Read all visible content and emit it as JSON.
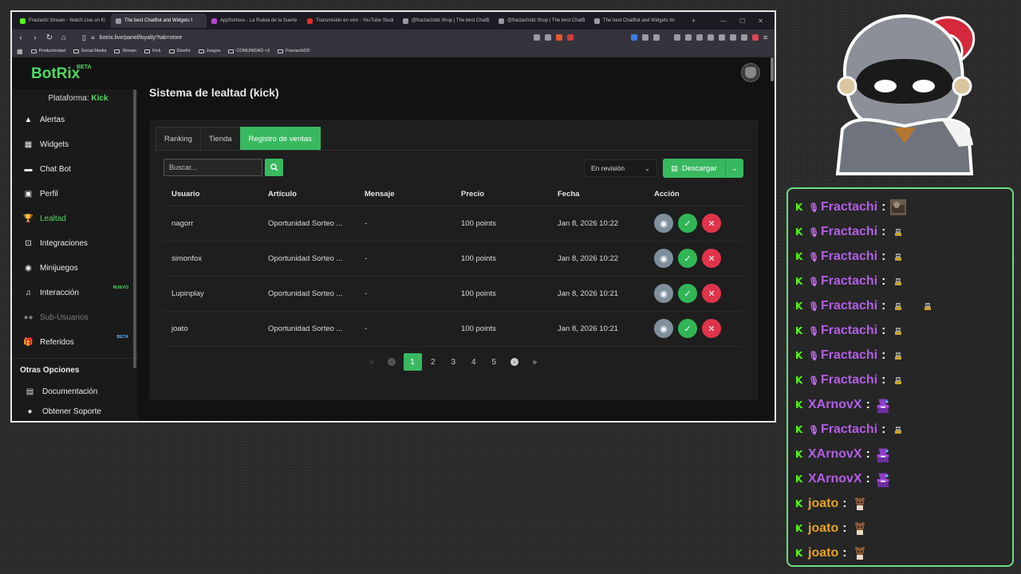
{
  "browser": {
    "tabs": [
      {
        "title": "Fractachi Stream - Watch Live on Ki",
        "color": "#53fc18",
        "active": false
      },
      {
        "title": "The best ChatBot and Widgets f",
        "color": "#9a9aa5",
        "active": true
      },
      {
        "title": "AppSorteos - La Ruleta de la Suerte",
        "color": "#b347d6",
        "active": false
      },
      {
        "title": "Transmisión en vivo - YouTube Studi",
        "color": "#e02f2f",
        "active": false
      },
      {
        "title": "@fractachidd Shop | The best ChatB",
        "color": "#9a9aa5",
        "active": false
      },
      {
        "title": "@fractachidd Shop | The best ChatB",
        "color": "#9a9aa5",
        "active": false
      },
      {
        "title": "The best ChatBot and Widgets for",
        "color": "#9a9aa5",
        "active": false
      }
    ],
    "url": "botrix.live/panel/loyalty?tab=store",
    "bookmarks": [
      "Productividad",
      "Social Media",
      "Stream",
      "Kick",
      "Diseño",
      "Juegos",
      "COMUNIDAD <3",
      "FractachiDD"
    ]
  },
  "app": {
    "logo": "BotRix",
    "logo_badge": "BETA",
    "platform_label": "Plataforma:",
    "platform_value": "Kick"
  },
  "sidebar": {
    "items": [
      {
        "label": "Alertas",
        "icon": "warning-icon",
        "glyph": "▲",
        "state": "normal",
        "badge": ""
      },
      {
        "label": "Widgets",
        "icon": "widgets-icon",
        "glyph": "▦",
        "state": "normal",
        "badge": ""
      },
      {
        "label": "Chat Bot",
        "icon": "chat-icon",
        "glyph": "▬",
        "state": "normal",
        "badge": ""
      },
      {
        "label": "Perfil",
        "icon": "profile-icon",
        "glyph": "▣",
        "state": "normal",
        "badge": ""
      },
      {
        "label": "Lealtad",
        "icon": "trophy-icon",
        "glyph": "🏆",
        "state": "active",
        "badge": ""
      },
      {
        "label": "Integraciones",
        "icon": "integrations-icon",
        "glyph": "⊡",
        "state": "normal",
        "badge": ""
      },
      {
        "label": "Minijuegos",
        "icon": "gamepad-icon",
        "glyph": "◉",
        "state": "normal",
        "badge": ""
      },
      {
        "label": "Interacción",
        "icon": "music-icon",
        "glyph": "♫",
        "state": "normal",
        "badge": "NUEVO"
      },
      {
        "label": "Sub-Usuarios",
        "icon": "users-icon",
        "glyph": "●●",
        "state": "disabled",
        "badge": ""
      },
      {
        "label": "Referidos",
        "icon": "gift-icon",
        "glyph": "🎁",
        "state": "normal",
        "badge": "BETA"
      }
    ],
    "other_title": "Otras Opciones",
    "docs_label": "Documentación",
    "support_label": "Obtener Soporte"
  },
  "main": {
    "title": "Sistema de lealtad (kick)",
    "tabs": [
      {
        "label": "Ranking",
        "active": false
      },
      {
        "label": "Tienda",
        "active": false
      },
      {
        "label": "Registro de ventas",
        "active": true
      }
    ],
    "search_placeholder": "Buscar...",
    "filter_value": "En revisión",
    "download_label": "Descargar",
    "columns": [
      "Usuario",
      "Artículo",
      "Mensaje",
      "Precio",
      "Fecha",
      "Acción"
    ],
    "rows": [
      {
        "user": "nagorr",
        "item": "Oportunidad Sorteo ...",
        "message": "-",
        "price": "100 points",
        "date": "Jan 8, 2026 10:22"
      },
      {
        "user": "simonfox",
        "item": "Oportunidad Sorteo ...",
        "message": "-",
        "price": "100 points",
        "date": "Jan 8, 2026 10:22"
      },
      {
        "user": "Lupinplay",
        "item": "Oportunidad Sorteo ...",
        "message": "-",
        "price": "100 points",
        "date": "Jan 8, 2026 10:21"
      },
      {
        "user": "joato",
        "item": "Oportunidad Sorteo ...",
        "message": "-",
        "price": "100 points",
        "date": "Jan 8, 2026 10:21"
      }
    ],
    "pagination": {
      "pages": [
        "1",
        "2",
        "3",
        "4",
        "5"
      ],
      "current": "1"
    }
  },
  "chat": {
    "messages": [
      {
        "user": "Fractachi",
        "mic": true,
        "color": "purple",
        "emotes": [
          "photo"
        ]
      },
      {
        "user": "Fractachi",
        "mic": true,
        "color": "purple",
        "emotes": [
          "tiny"
        ]
      },
      {
        "user": "Fractachi",
        "mic": true,
        "color": "purple",
        "emotes": [
          "tiny"
        ]
      },
      {
        "user": "Fractachi",
        "mic": true,
        "color": "purple",
        "emotes": [
          "tiny"
        ]
      },
      {
        "user": "Fractachi",
        "mic": true,
        "color": "purple",
        "emotes": [
          "tiny",
          "tiny"
        ]
      },
      {
        "user": "Fractachi",
        "mic": true,
        "color": "purple",
        "emotes": [
          "tiny"
        ]
      },
      {
        "user": "Fractachi",
        "mic": true,
        "color": "purple",
        "emotes": [
          "tiny"
        ]
      },
      {
        "user": "Fractachi",
        "mic": true,
        "color": "purple",
        "emotes": [
          "tiny"
        ]
      },
      {
        "user": "XArnovX",
        "mic": false,
        "color": "purple",
        "emotes": [
          "wizard"
        ]
      },
      {
        "user": "Fractachi",
        "mic": true,
        "color": "purple",
        "emotes": [
          "tiny"
        ]
      },
      {
        "user": "XArnovX",
        "mic": false,
        "color": "purple",
        "emotes": [
          "wizard"
        ]
      },
      {
        "user": "XArnovX",
        "mic": false,
        "color": "purple",
        "emotes": [
          "wizard"
        ]
      },
      {
        "user": "joato",
        "mic": false,
        "color": "orange",
        "emotes": [
          "bear"
        ]
      },
      {
        "user": "joato",
        "mic": false,
        "color": "orange",
        "emotes": [
          "bear"
        ]
      },
      {
        "user": "joato",
        "mic": false,
        "color": "orange",
        "emotes": [
          "bear"
        ]
      }
    ]
  },
  "colors": {
    "accent": "#38b960",
    "kick": "#53fc18",
    "danger": "#e0344b"
  }
}
